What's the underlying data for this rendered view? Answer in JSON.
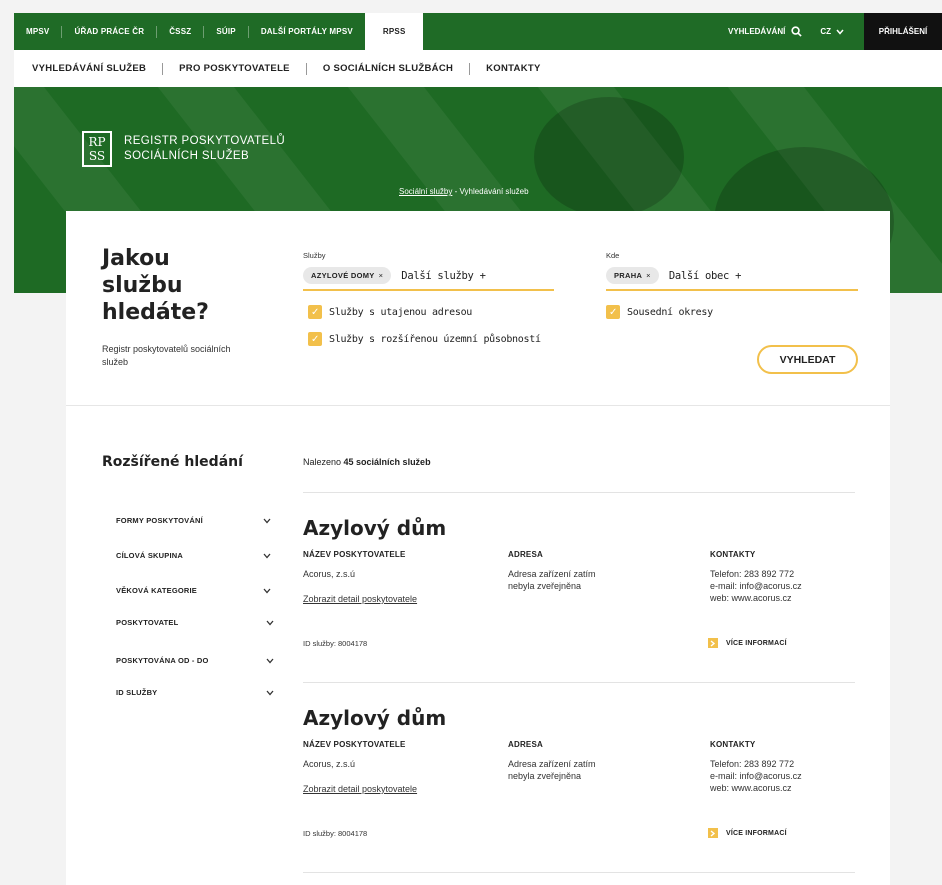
{
  "topbar": {
    "links": [
      "MPSV",
      "ÚŘAD PRÁCE ČR",
      "ČSSZ",
      "SÚIP",
      "DALŠÍ PORTÁLY MPSV",
      "RPSS"
    ],
    "search_label": "VYHLEDÁVÁNÍ",
    "lang": "CZ",
    "login": "PŘIHLÁŠENÍ"
  },
  "subnav": {
    "links": [
      "VYHLEDÁVÁNÍ SLUŽEB",
      "PRO POSKYTOVATELE",
      "O SOCIÁLNÍCH SLUŽBÁCH",
      "KONTAKTY"
    ]
  },
  "hero": {
    "logo_mark_top": "RP",
    "logo_mark_bottom": "SS",
    "logo_line1": "REGISTR POSKYTOVATELŮ",
    "logo_line2": "SOCIÁLNÍCH SLUŽEB",
    "breadcrumb_link": "Sociální služby",
    "breadcrumb_sep": " - ",
    "breadcrumb_current": "Vyhledávání služeb"
  },
  "search": {
    "question": "Jakou službu hledáte?",
    "subtitle": "Registr poskytovatelů sociálních služeb",
    "services_label": "Služby",
    "services_chip": "AZYLOVÉ DOMY",
    "services_more": "Další služby +",
    "where_label": "Kde",
    "where_chip": "PRAHA",
    "where_more": "Další obec +",
    "chip_remove": "×",
    "checkbox1": "Služby s utajenou adresou",
    "checkbox2": "Služby s rozšířenou územní působností",
    "checkbox3": "Sousední okresy",
    "check_mark": "✓",
    "button": "VYHLEDAT"
  },
  "advanced": {
    "title": "Rozšířené hledání",
    "filters": [
      "FORMY POSKYTOVÁNÍ",
      "CÍLOVÁ SKUPINA",
      "VĚKOVÁ KATEGORIE",
      "POSKYTOVATEL",
      "POSKYTOVÁNA OD - DO",
      "ID SLUŽBY"
    ]
  },
  "results": {
    "found_prefix": "Nalezeno ",
    "found_count": "45 sociálních služeb",
    "items": [
      {
        "title": "Azylový dům",
        "provider_header": "NÁZEV POSKYTOVATELE",
        "provider": "Acorus, z.s.ú",
        "provider_link": "Zobrazit detail poskytovatele",
        "address_header": "ADRESA",
        "address_line1": "Adresa zařízení zatím",
        "address_line2": "nebyla zveřejněna",
        "contacts_header": "KONTAKTY",
        "phone": "Telefon: 283 892 772",
        "email": "e-mail: info@acorus.cz",
        "web": "web: www.acorus.cz",
        "id": "ID služby: 8004178",
        "more": "VÍCE INFORMACÍ"
      },
      {
        "title": "Azylový dům",
        "provider_header": "NÁZEV POSKYTOVATELE",
        "provider": "Acorus, z.s.ú",
        "provider_link": "Zobrazit detail poskytovatele",
        "address_header": "ADRESA",
        "address_line1": "Adresa zařízení zatím",
        "address_line2": "nebyla zveřejněna",
        "contacts_header": "KONTAKTY",
        "phone": "Telefon: 283 892 772",
        "email": "e-mail: info@acorus.cz",
        "web": "web: www.acorus.cz",
        "id": "ID služby: 8004178",
        "more": "VÍCE INFORMACÍ"
      }
    ]
  },
  "colors": {
    "brand_green": "#1f6b26",
    "accent_yellow": "#f2c04b"
  },
  "icons": {
    "search": "search-icon",
    "lang": "chevron-down-icon",
    "filter": "chevron-down-icon",
    "more": "arrow-right-icon",
    "check": "checkmark-icon"
  }
}
